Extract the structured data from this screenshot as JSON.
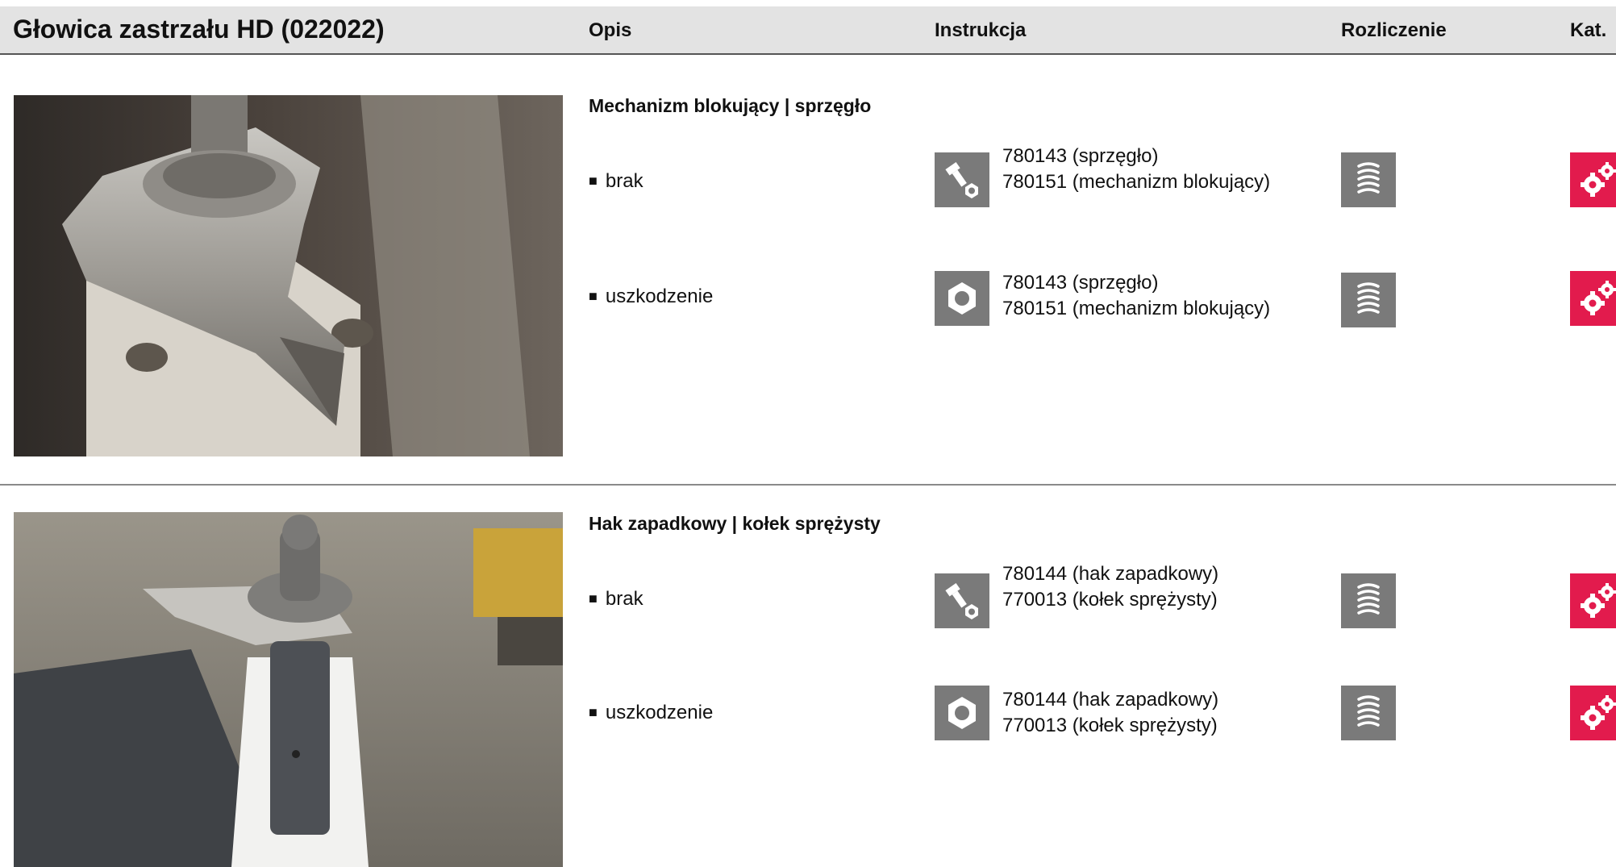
{
  "header": {
    "title": "Głowica zastrzału HD (022022)",
    "columns": {
      "opis": "Opis",
      "instrukcja": "Instrukcja",
      "rozliczenie": "Rozliczenie",
      "kat": "Kat."
    }
  },
  "sections": [
    {
      "title": "Mechanizm blokujący | sprzęgło",
      "rows": [
        {
          "label": "brak",
          "instruction_icon": "bolt-nut-icon",
          "parts": [
            "780143 (sprzęgło)",
            "780151 (mechanizm blokujący)"
          ],
          "billing_icon": "coil-spring-icon",
          "catalog_icon": "gears-icon"
        },
        {
          "label": "uszkodzenie",
          "instruction_icon": "hex-nut-icon",
          "parts": [
            "780143 (sprzęgło)",
            "780151 (mechanizm blokujący)"
          ],
          "billing_icon": "coil-spring-icon",
          "catalog_icon": "gears-icon"
        }
      ]
    },
    {
      "title": "Hak zapadkowy | kołek sprężysty",
      "rows": [
        {
          "label": "brak",
          "instruction_icon": "bolt-nut-icon",
          "parts": [
            "780144 (hak zapadkowy)",
            "770013 (kołek sprężysty)"
          ],
          "billing_icon": "coil-spring-icon",
          "catalog_icon": "gears-icon"
        },
        {
          "label": "uszkodzenie",
          "instruction_icon": "hex-nut-icon",
          "parts": [
            "780144 (hak zapadkowy)",
            "770013 (kołek sprężysty)"
          ],
          "billing_icon": "coil-spring-icon",
          "catalog_icon": "gears-icon"
        }
      ]
    }
  ],
  "colors": {
    "header_bg": "#e3e3e3",
    "icon_gray": "#7a7a7a",
    "catalog_red": "#e21b4d"
  }
}
